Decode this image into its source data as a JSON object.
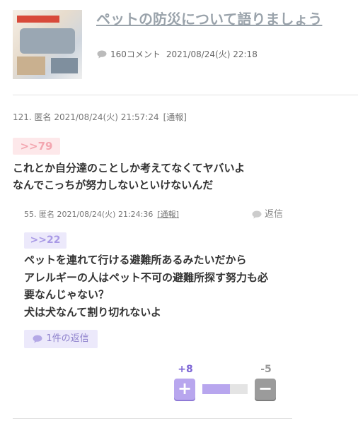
{
  "topic": {
    "title": "ペットの防災について語りましょう",
    "comment_count": "160コメント",
    "datetime": "2021/08/24(火) 22:18"
  },
  "comment": {
    "header": "121. 匿名 2021/08/24(火) 21:57:24",
    "report_label": "[通報]",
    "anchor": ">>79",
    "lines": [
      "これとか自分達のことしか考えてなくてヤバいよ",
      "なんでこっちが努力しないといけないんだ"
    ]
  },
  "quoted": {
    "header": "55. 匿名 2021/08/24(火) 21:24:36",
    "report_label": "[通報]",
    "reply_label": "返信",
    "anchor": ">>22",
    "lines": [
      "ペットを連れて行ける避難所あるみたいだから",
      "アレルギーの人はペット不可の避難所探す努力も必",
      "要なんじゃない？",
      "犬は犬なんて割り切れないよ"
    ],
    "replies_label": "1件の返信"
  },
  "votes": {
    "plus": "+8",
    "minus": "-5",
    "plus_symbol": "+",
    "minus_symbol": "−",
    "plus_share": 0.615
  },
  "colors": {
    "accent": "#b8a6ee",
    "title": "#9aa3ab",
    "anchor_pink": "#fde8ea",
    "anchor_lavender": "#ece9fb"
  }
}
